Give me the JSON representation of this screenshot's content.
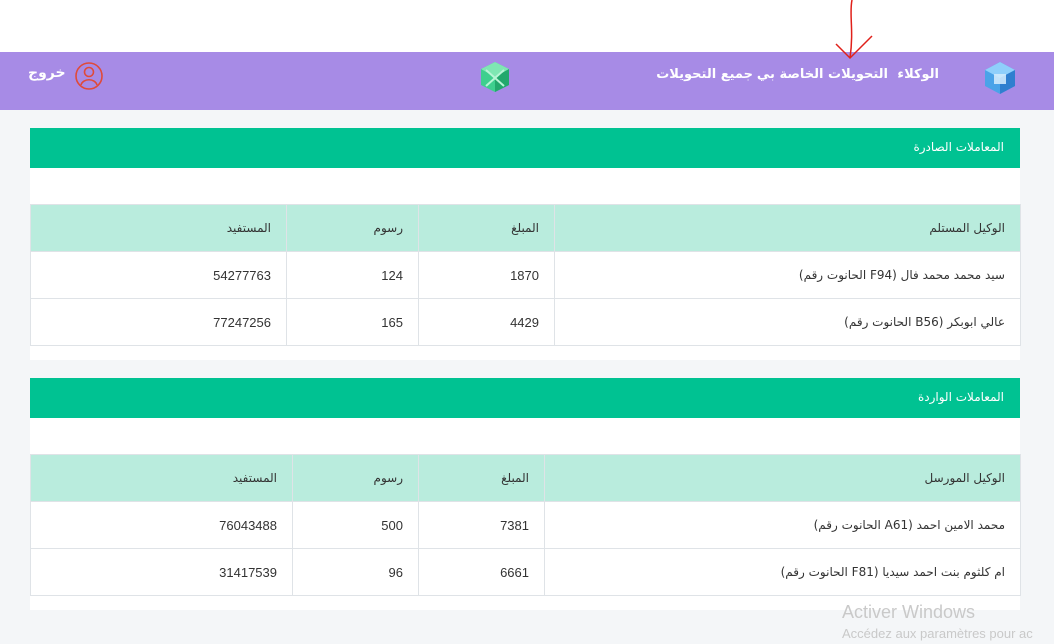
{
  "nav": {
    "agents": "الوكلاء",
    "my_transfers": "التحويلات الخاصة بي",
    "all_transfers": "جميع التحويلات",
    "logout": "خروج",
    "logo_icon": "cube-logo-icon",
    "center_icon": "green-cube-icon",
    "user_icon": "user-circle-icon"
  },
  "colors": {
    "navbar": "#a78be6",
    "panel_header": "#00c292",
    "table_header": "#b9ecdd"
  },
  "outgoing": {
    "title": "المعاملات الصادرة",
    "headers": [
      "الوكيل المستلم",
      "المبلغ",
      "رسوم",
      "المستفيد"
    ],
    "rows": [
      [
        "سيد محمد محمد فال (F94 الحانوت رقم)",
        "1870",
        "124",
        "54277763"
      ],
      [
        "عالي ابوبكر (B56 الحانوت رقم)",
        "4429",
        "165",
        "77247256"
      ]
    ]
  },
  "incoming": {
    "title": "المعاملات الواردة",
    "headers": [
      "الوكيل المورسل",
      "المبلغ",
      "رسوم",
      "المستفيد"
    ],
    "rows": [
      [
        "محمد الامين احمد (A61 الحانوت رقم)",
        "7381",
        "500",
        "76043488"
      ],
      [
        "ام كلثوم بنت احمد سيديا (F81 الحانوت رقم)",
        "6661",
        "96",
        "31417539"
      ]
    ]
  },
  "watermark": {
    "line1": "Activer Windows",
    "line2": "Accédez aux paramètres pour ac"
  }
}
